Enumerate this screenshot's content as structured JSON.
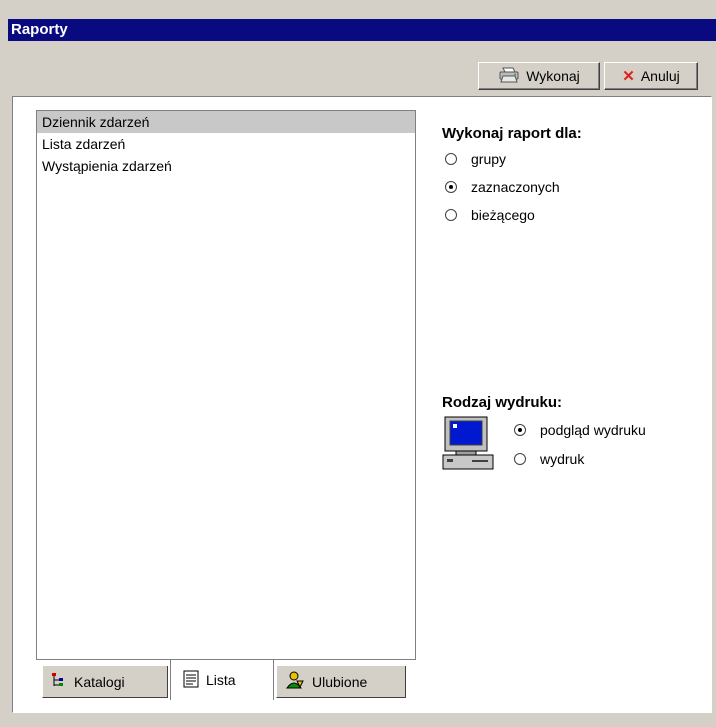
{
  "window": {
    "title": "Raporty"
  },
  "toolbar": {
    "execute_label": "Wykonaj",
    "cancel_label": "Anuluj"
  },
  "report_list": {
    "items": [
      "Dziennik zdarzeń",
      "Lista zdarzeń",
      "Wystąpienia zdarzeń"
    ],
    "selected_index": 0
  },
  "tabs": [
    {
      "label": "Katalogi",
      "icon": "tree-icon",
      "active": false
    },
    {
      "label": "Lista",
      "icon": "list-icon",
      "active": true
    },
    {
      "label": "Ulubione",
      "icon": "person-icon",
      "active": false
    }
  ],
  "report_for": {
    "title": "Wykonaj raport dla:",
    "options": [
      "grupy",
      "zaznaczonych",
      "bieżącego"
    ],
    "selected_index": 1
  },
  "print_type": {
    "title": "Rodzaj wydruku:",
    "icon": "computer-monitor-icon",
    "options": [
      "podgląd wydruku",
      "wydruk"
    ],
    "selected_index": 0
  }
}
